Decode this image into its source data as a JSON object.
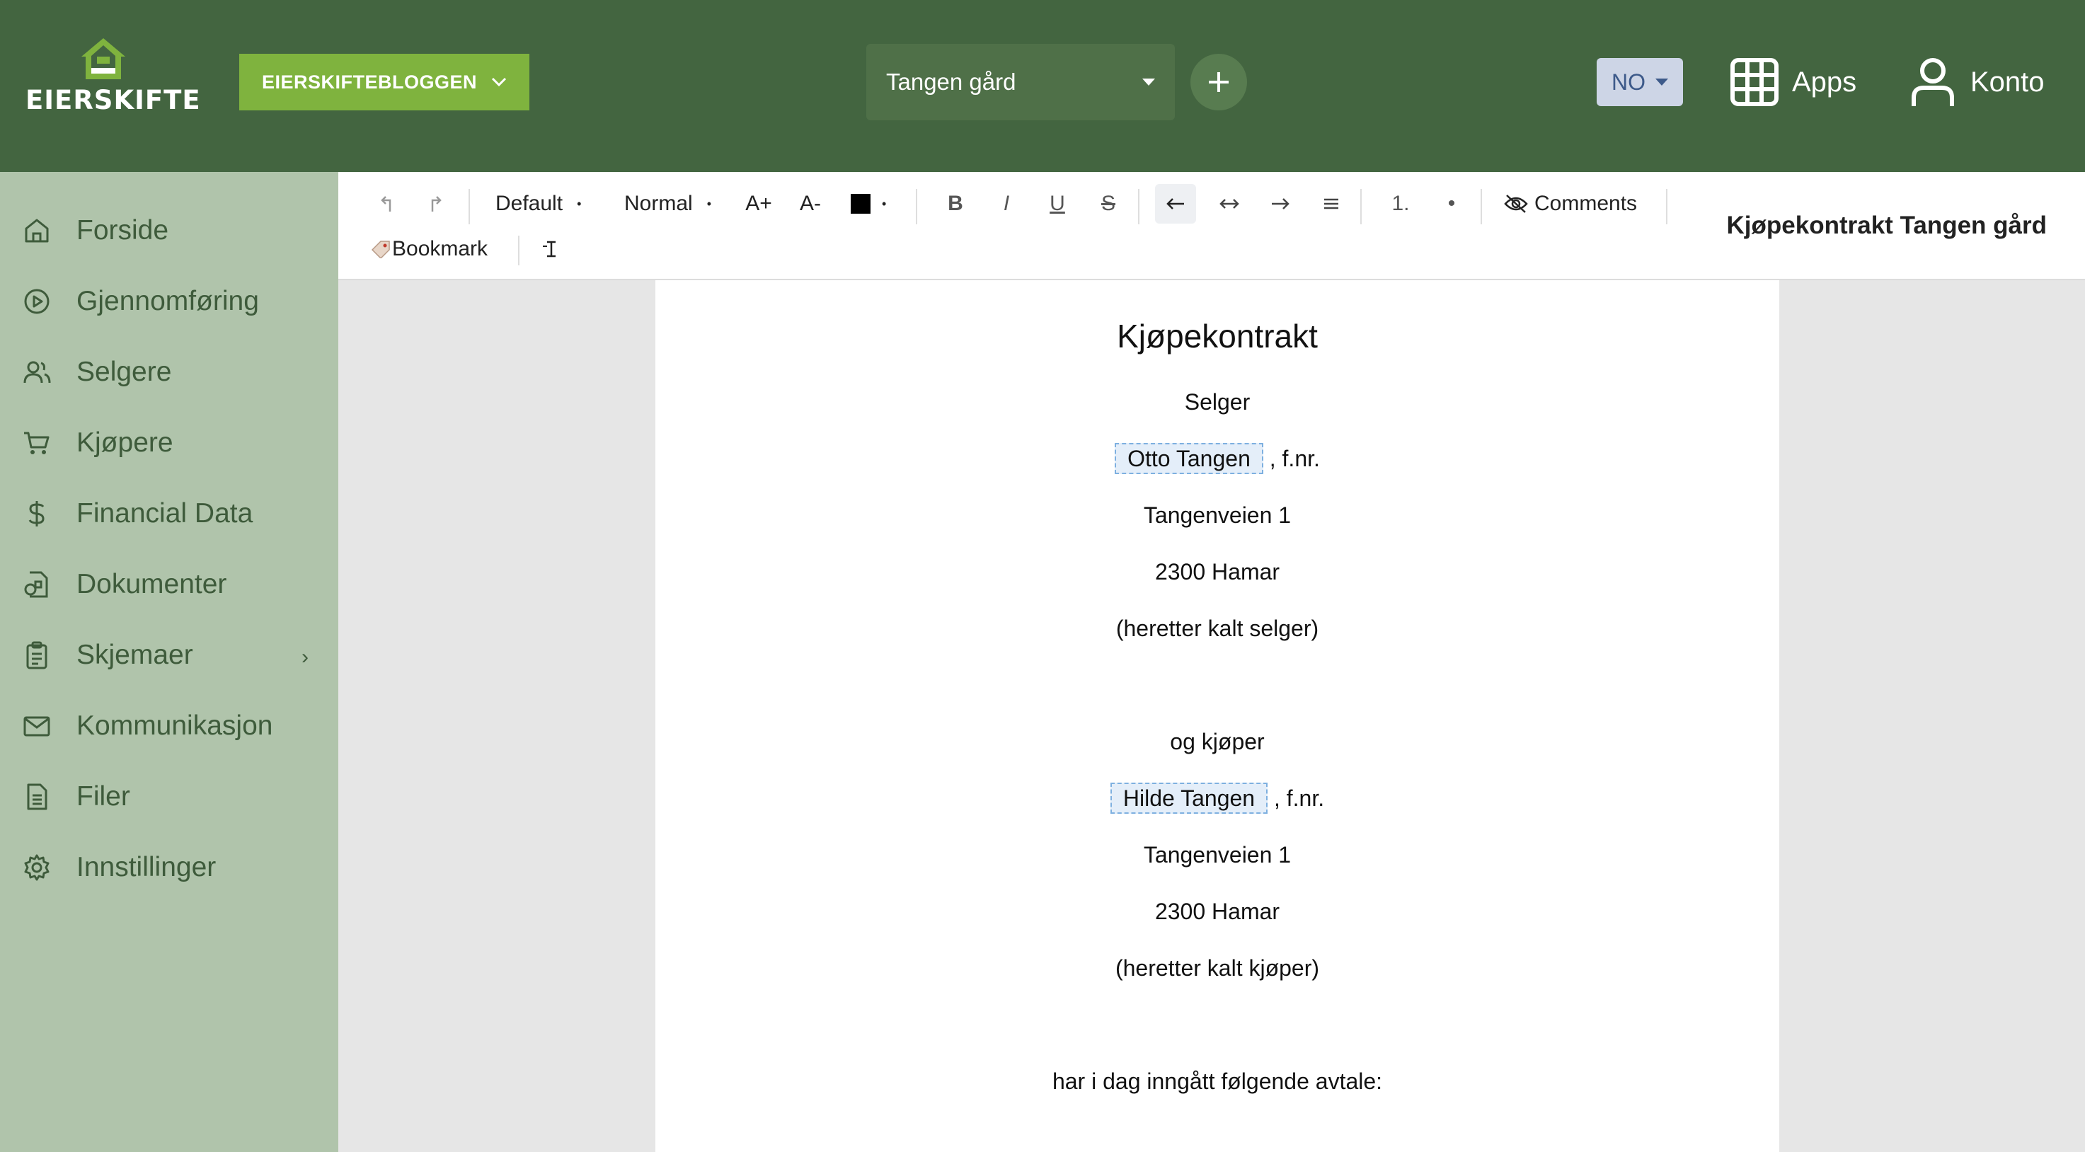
{
  "header": {
    "logo_text": "EIERSKIFTE",
    "blog_button": "EIERSKIFTEBLOGGEN",
    "farm_select": "Tangen gård",
    "language": "NO",
    "apps_label": "Apps",
    "account_label": "Konto"
  },
  "sidebar": {
    "items": [
      {
        "label": "Forside",
        "icon": "home-icon"
      },
      {
        "label": "Gjennomføring",
        "icon": "play-icon"
      },
      {
        "label": "Selgere",
        "icon": "users-icon"
      },
      {
        "label": "Kjøpere",
        "icon": "cart-icon"
      },
      {
        "label": "Financial Data",
        "icon": "dollar-icon"
      },
      {
        "label": "Dokumenter",
        "icon": "document-shapes-icon"
      },
      {
        "label": "Skjemaer",
        "icon": "clipboard-icon",
        "chevron": "›"
      },
      {
        "label": "Kommunikasjon",
        "icon": "mail-icon"
      },
      {
        "label": "Filer",
        "icon": "file-icon"
      },
      {
        "label": "Innstillinger",
        "icon": "gear-icon"
      }
    ]
  },
  "toolbar": {
    "font_family": "Default",
    "font_style": "Normal",
    "grow": "A+",
    "shrink": "A-",
    "bold": "B",
    "italic": "I",
    "underline": "U",
    "strike": "S",
    "ordered_list": "1.",
    "bullet_list": "•",
    "comments": "Comments",
    "bookmark": "Bookmark",
    "text_color": "#000000",
    "document_title": "Kjøpekontrakt Tangen gård"
  },
  "document": {
    "heading": "Kjøpekontrakt",
    "seller_heading": "Selger",
    "seller_name": "Otto Tangen",
    "fnr_suffix": ", f.nr.",
    "seller_street": "Tangenveien 1",
    "seller_city": "2300 Hamar",
    "seller_note": "(heretter kalt selger)",
    "buyer_heading": "og kjøper",
    "buyer_name": "Hilde Tangen",
    "buyer_street": "Tangenveien 1",
    "buyer_city": "2300 Hamar",
    "buyer_note": "(heretter kalt kjøper)",
    "agreement": "har i dag inngått følgende avtale:"
  },
  "colors": {
    "header_bg": "#436540",
    "accent_green": "#7fb33e",
    "sidebar_bg": "#b0c4ab",
    "sidebar_text": "#3e5b3b"
  }
}
